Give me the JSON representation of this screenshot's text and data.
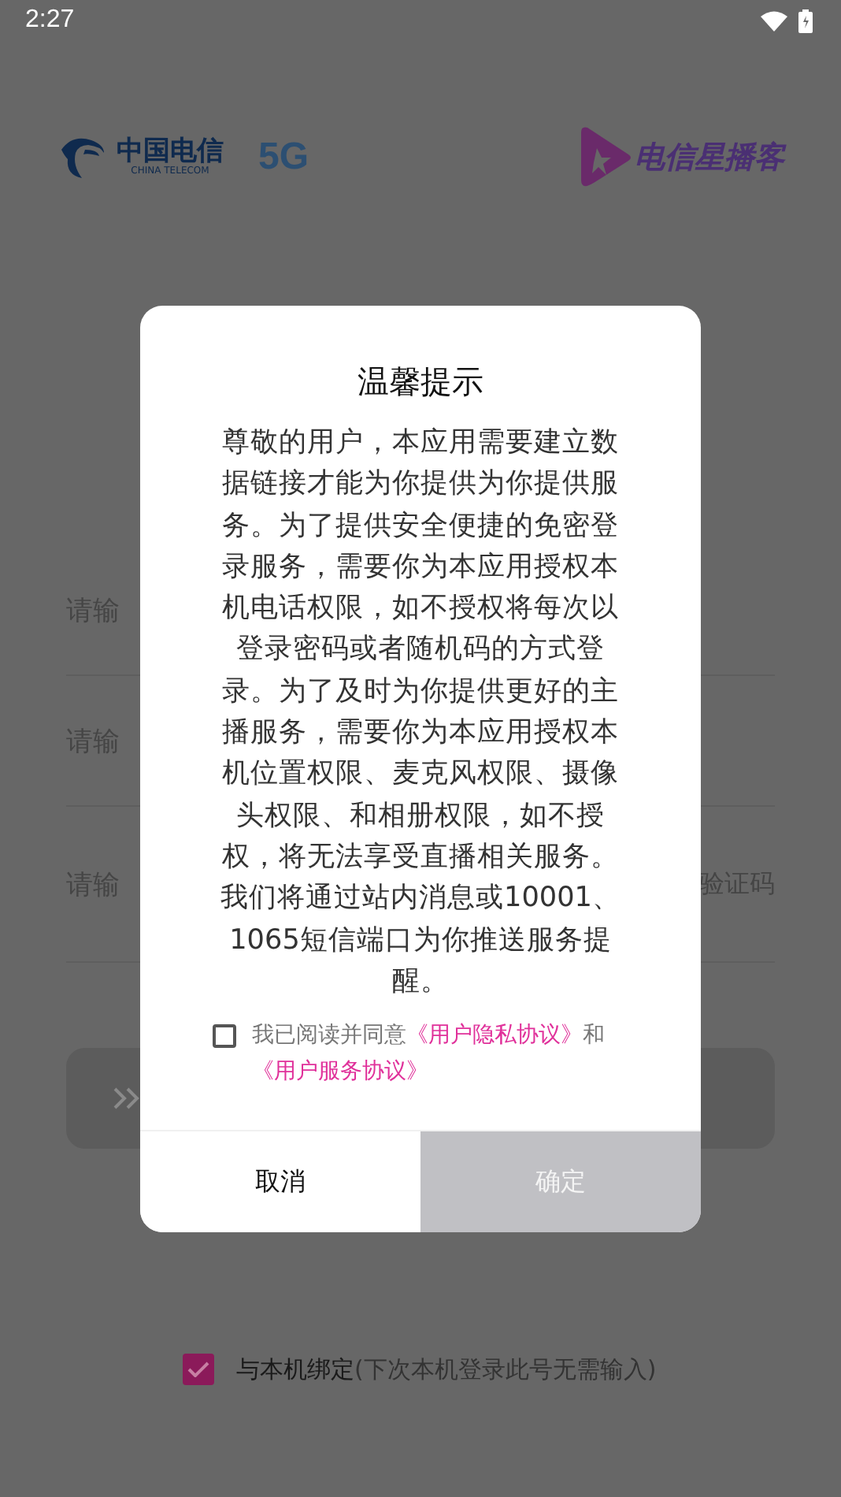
{
  "status_bar": {
    "time": "2:27"
  },
  "logos": {
    "brand_cn": "中国电信",
    "brand_en": "CHINA TELECOM",
    "badge": "5G",
    "app_name": "电信星播客"
  },
  "form": {
    "fields": [
      {
        "placeholder": "请输"
      },
      {
        "placeholder": "请输"
      },
      {
        "placeholder": "请输",
        "action": "验证码"
      }
    ]
  },
  "bind": {
    "checked": true,
    "label": "与本机绑定",
    "hint": "(下次本机登录此号无需输入)"
  },
  "dialog": {
    "title": "温馨提示",
    "body": "尊敬的用户，本应用需要建立数据链接才能为你提供为你提供服务。为了提供安全便捷的免密登录服务，需要你为本应用授权本机电话权限，如不授权将每次以登录密码或者随机码的方式登录。为了及时为你提供更好的主播服务，需要你为本应用授权本机位置权限、麦克风权限、摄像头权限、和相册权限，如不授权，将无法享受直播相关服务。我们将通过站内消息或10001、1065短信端口为你推送服务提醒。",
    "agree": {
      "checked": false,
      "text": "我已阅读并同意",
      "link1": "《用户隐私协议》",
      "joiner": "和",
      "link2": "《用户服务协议》"
    },
    "buttons": [
      {
        "label": "取消",
        "kind": "cancel"
      },
      {
        "label": "确定",
        "kind": "confirm",
        "disabled": true
      }
    ]
  }
}
